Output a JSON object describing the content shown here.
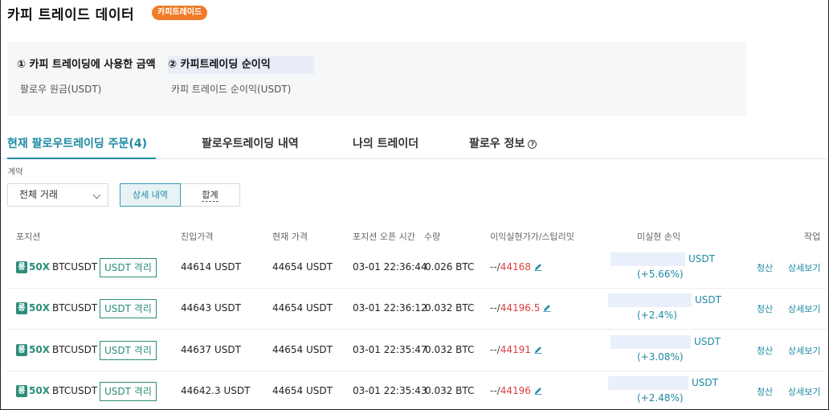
{
  "header": {
    "title": "카피 트레이드 데이터",
    "badge": "카피트레이드"
  },
  "summary": {
    "col1_title": "① 카피 트레이딩에 사용한 금액",
    "col1_sub": "팔로우 원금(USDT)",
    "col2_title": "② 카피트레이딩 순이익",
    "col2_sub": "카피 트레이드 순이익(USDT)"
  },
  "tabs": [
    {
      "label": "현재 팔로우트레이딩 주문(4)",
      "active": true
    },
    {
      "label": "팔로우트레이딩 내역",
      "active": false
    },
    {
      "label": "나의 트레이더",
      "active": false
    },
    {
      "label": "팔로우 정보",
      "active": false
    }
  ],
  "filters": {
    "contract_label": "계약",
    "contract_value": "전체 거래",
    "segment_detail": "상세 내역",
    "segment_total": "합계"
  },
  "table": {
    "headers": {
      "position": "포지션",
      "entry": "진입가격",
      "current": "현재 가격",
      "open_time": "포지션 오픈 시간",
      "qty": "수량",
      "tpsl": "이익실현가가/스탑리밋",
      "pnl": "미실현 손익",
      "action": "작업"
    },
    "rows": [
      {
        "side": "롱",
        "leverage": "50X",
        "symbol": "BTCUSDT",
        "margin": "USDT 격리",
        "entry": "44614 USDT",
        "current": "44654 USDT",
        "open_time": "03-01 22:36:44",
        "qty": "0.026 BTC",
        "tp": "--",
        "sl": "44168",
        "pnl_unit": "USDT",
        "pnl_pct": "(+5.66%)",
        "close": "청산",
        "detail": "상세보기"
      },
      {
        "side": "롱",
        "leverage": "50X",
        "symbol": "BTCUSDT",
        "margin": "USDT 격리",
        "entry": "44643 USDT",
        "current": "44654 USDT",
        "open_time": "03-01 22:36:12",
        "qty": "0.032 BTC",
        "tp": "--",
        "sl": "44196.5",
        "pnl_unit": "USDT",
        "pnl_pct": "(+2.4%)",
        "close": "청산",
        "detail": "상세보기"
      },
      {
        "side": "롱",
        "leverage": "50X",
        "symbol": "BTCUSDT",
        "margin": "USDT 격리",
        "entry": "44637 USDT",
        "current": "44654 USDT",
        "open_time": "03-01 22:35:47",
        "qty": "0.032 BTC",
        "tp": "--",
        "sl": "44191",
        "pnl_unit": "USDT",
        "pnl_pct": "(+3.08%)",
        "close": "청산",
        "detail": "상세보기"
      },
      {
        "side": "롱",
        "leverage": "50X",
        "symbol": "BTCUSDT",
        "margin": "USDT 격리",
        "entry": "44642.3 USDT",
        "current": "44654 USDT",
        "open_time": "03-01 22:35:43",
        "qty": "0.032 BTC",
        "tp": "--",
        "sl": "44196",
        "pnl_unit": "USDT",
        "pnl_pct": "(+2.48%)",
        "close": "청산",
        "detail": "상세보기"
      }
    ]
  },
  "colors": {
    "accent": "#1f8aa3",
    "long": "#2b8d7a",
    "badge": "#f07b2a",
    "stop": "#d94040"
  }
}
